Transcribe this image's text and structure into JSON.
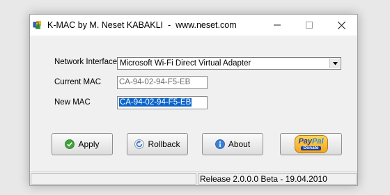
{
  "window": {
    "title": "K-MAC by M. Neset KABAKLI  -  www.neset.com"
  },
  "form": {
    "network_interface_label": "Network Interface",
    "network_interface_value": "Microsoft Wi-Fi Direct Virtual Adapter",
    "current_mac_label": "Current MAC",
    "current_mac_value": "CA-94-02-94-F5-EB",
    "new_mac_label": "New MAC",
    "new_mac_value": "CA-94-02-94-F5-EB"
  },
  "buttons": {
    "apply_label": "Apply",
    "rollback_label": "Rollback",
    "about_label": "About",
    "paypal_word_pay": "Pay",
    "paypal_word_pal": "Pal",
    "paypal_donate": "Donate"
  },
  "status": {
    "release": "Release 2.0.0.0 Beta - 19.04.2010"
  },
  "icons": {
    "app": "app-icon",
    "minimize": "minimize-icon",
    "maximize": "maximize-icon",
    "close": "close-icon",
    "dropdown": "chevron-down-icon",
    "apply": "check-icon",
    "rollback": "rollback-icon",
    "about": "info-icon"
  },
  "colors": {
    "selection": "#0a63c9",
    "paypal_gold": "#f2a622",
    "paypal_blue": "#1c3f94"
  }
}
